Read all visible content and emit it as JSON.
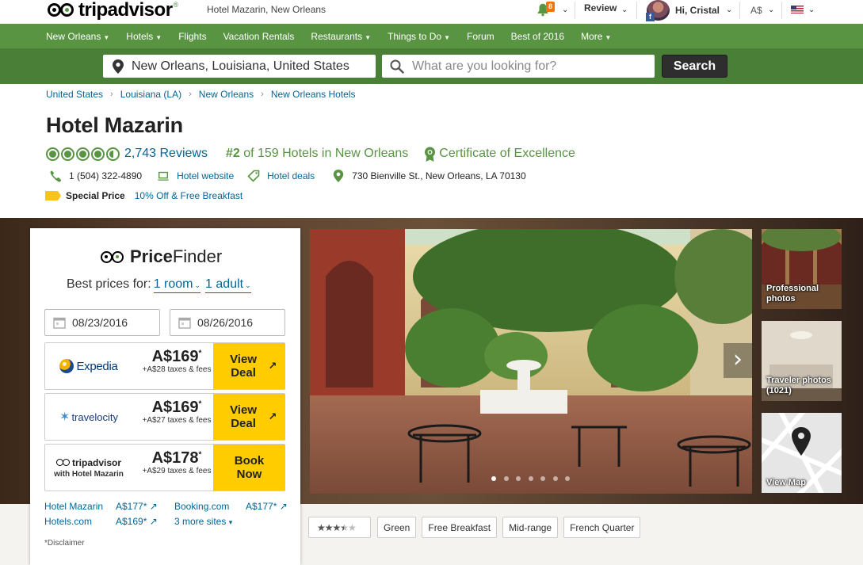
{
  "header": {
    "logo_text": "tripadvisor",
    "hotel_breadcrumb": "Hotel Mazarin, New Orleans",
    "notification_count": "8",
    "review_label": "Review",
    "user_greeting": "Hi, Cristal",
    "currency": "A$",
    "facebook_badge": "f"
  },
  "nav": {
    "items": [
      {
        "label": "New Orleans",
        "dropdown": true
      },
      {
        "label": "Hotels",
        "dropdown": true
      },
      {
        "label": "Flights",
        "dropdown": false
      },
      {
        "label": "Vacation Rentals",
        "dropdown": false
      },
      {
        "label": "Restaurants",
        "dropdown": true
      },
      {
        "label": "Things to Do",
        "dropdown": true
      },
      {
        "label": "Forum",
        "dropdown": false
      },
      {
        "label": "Best of 2016",
        "dropdown": false
      },
      {
        "label": "More",
        "dropdown": true
      }
    ]
  },
  "search": {
    "geo_value": "New Orleans, Louisiana, United States",
    "what_placeholder": "What are you looking for?",
    "button_label": "Search"
  },
  "breadcrumb": [
    "United States",
    "Louisiana (LA)",
    "New Orleans",
    "New Orleans Hotels"
  ],
  "hotel": {
    "name": "Hotel Mazarin",
    "rating": 4.5,
    "reviews": "2,743 Reviews",
    "rank_num": "#2",
    "rank_text": " of 159 Hotels in New Orleans",
    "certificate": "Certificate of Excellence",
    "phone": "1 (504) 322-4890",
    "website": "Hotel website",
    "deals": "Hotel deals",
    "address": "730 Bienville St., New Orleans, LA 70130",
    "special_label": "Special Price",
    "special_deal": "10% Off & Free Breakfast"
  },
  "pricefinder": {
    "title_bold": "Price",
    "title_rest": "Finder",
    "prices_for": "Best prices for:",
    "rooms": "1 room",
    "adults": "1 adult",
    "checkin": "08/23/2016",
    "checkout": "08/26/2016",
    "offers": [
      {
        "provider": "Expedia",
        "price": "A$169",
        "taxes": "+A$28 taxes & fees",
        "cta": "View Deal"
      },
      {
        "provider": "travelocity",
        "price": "A$169",
        "taxes": "+A$27 taxes & fees",
        "cta": "View Deal"
      },
      {
        "provider": "tripadvisor",
        "provider_sub": "with Hotel Mazarin",
        "price": "A$178",
        "taxes": "+A$29 taxes & fees",
        "cta": "Book Now"
      }
    ],
    "other_sites": [
      {
        "name": "Hotel Mazarin",
        "price": "A$177*"
      },
      {
        "name": "Booking.com",
        "price": "A$177*"
      },
      {
        "name": "Hotels.com",
        "price": "A$169*"
      }
    ],
    "more_sites": "3 more sites",
    "disclaimer": "*Disclaimer"
  },
  "gallery": {
    "thumbs": [
      {
        "caption": "Professional photos"
      },
      {
        "caption": "Traveler photos (1021)"
      },
      {
        "caption": "View Map"
      }
    ],
    "slide_count": 7,
    "active_slide": 0
  },
  "tags": [
    "Green",
    "Free Breakfast",
    "Mid-range",
    "French Quarter"
  ],
  "hotel_class_stars": 3.5,
  "colors": {
    "brand_green": "#589442",
    "link_blue": "#069",
    "cta_yellow": "#fc0"
  }
}
